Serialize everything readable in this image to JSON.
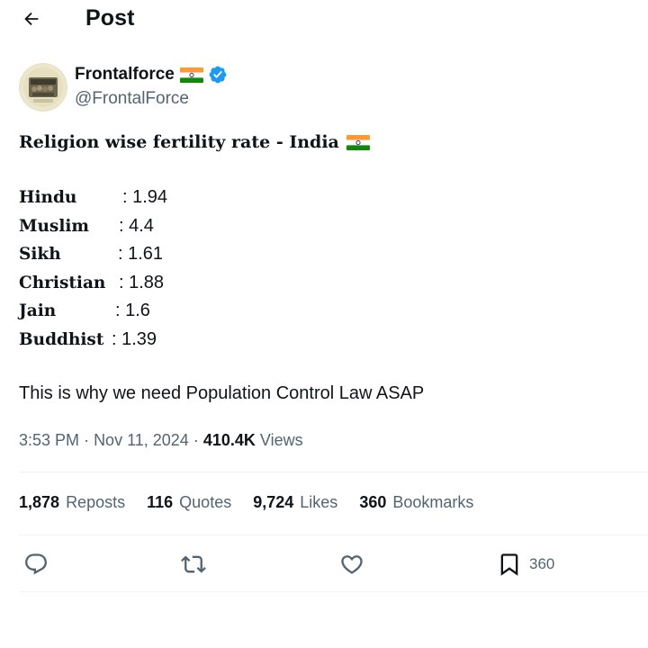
{
  "header": {
    "title": "Post"
  },
  "author": {
    "display_name": "Frontalforce",
    "handle": "@FrontalForce"
  },
  "tweet": {
    "headline": "Religion wise fertility rate - India",
    "rates": [
      {
        "religion": "Hindu",
        "value": ": 1.94"
      },
      {
        "religion": "Muslim",
        "value": ": 4.4"
      },
      {
        "religion": "Sikh",
        "value": ": 1.61"
      },
      {
        "religion": "Christian",
        "value": ": 1.88"
      },
      {
        "religion": "Jain",
        "value": ": 1.6"
      },
      {
        "religion": "Buddhist",
        "value": ": 1.39"
      }
    ],
    "closing": "This is why we need Population Control Law ASAP"
  },
  "meta": {
    "time": "3:53 PM",
    "date": "Nov 11, 2024",
    "views_count": "410.4K",
    "views_label": "Views"
  },
  "stats": {
    "reposts": {
      "count": "1,878",
      "label": "Reposts"
    },
    "quotes": {
      "count": "116",
      "label": "Quotes"
    },
    "likes": {
      "count": "9,724",
      "label": "Likes"
    },
    "bookmarks": {
      "count": "360",
      "label": "Bookmarks"
    }
  },
  "actions": {
    "bookmark_count": "360"
  },
  "colors": {
    "text": "#0f1419",
    "secondary": "#536471",
    "verified": "#1d9bf0",
    "divider": "#eff3f4"
  },
  "icons": [
    "back-arrow-icon",
    "flag-india-icon",
    "verified-badge-icon",
    "reply-icon",
    "repost-icon",
    "like-icon",
    "bookmark-icon"
  ]
}
